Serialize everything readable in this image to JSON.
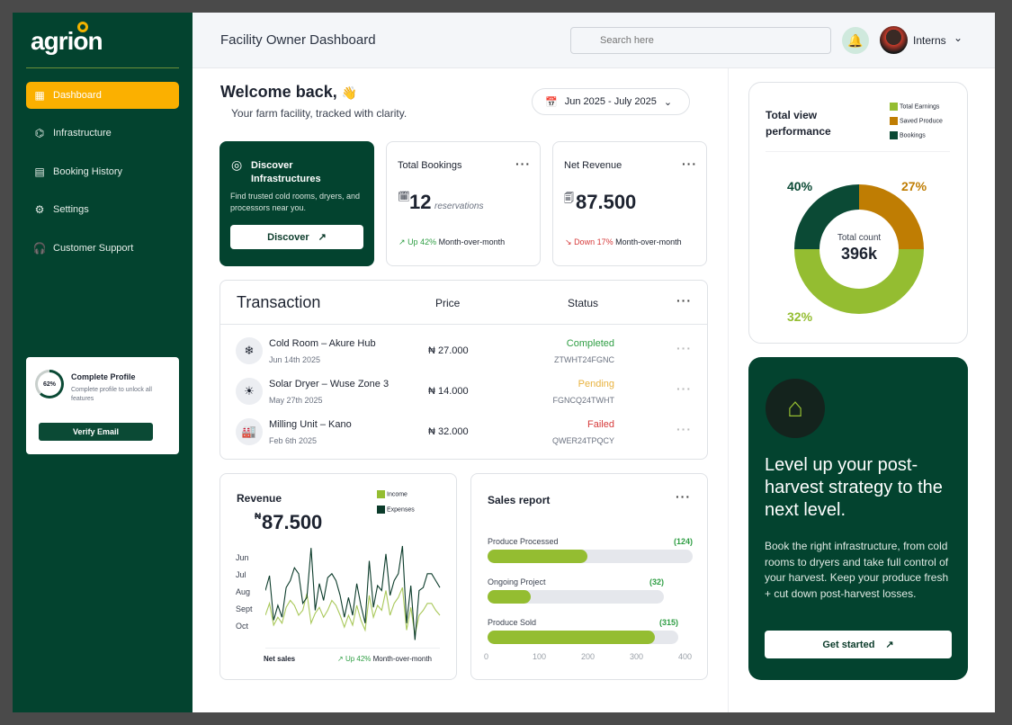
{
  "brand": {
    "name": "agrion"
  },
  "sidebar": {
    "items": [
      {
        "label": "Dashboard",
        "icon": "grid-icon"
      },
      {
        "label": "Infrastructure",
        "icon": "boxes-icon"
      },
      {
        "label": "Booking History",
        "icon": "receipt-search-icon"
      },
      {
        "label": "Settings",
        "icon": "gear-icon"
      },
      {
        "label": "Customer Support",
        "icon": "headset-icon"
      }
    ],
    "profile": {
      "percent": "62%",
      "title": "Complete Profile",
      "desc": "Complete profile to unlock all features",
      "button": "Verify Email"
    }
  },
  "header": {
    "title": "Facility Owner Dashboard",
    "search_placeholder": "Search here",
    "user": "Interns"
  },
  "welcome": {
    "title": "Welcome back,",
    "emoji": "👋",
    "subtitle": "Your farm facility, tracked with clarity.",
    "date_range": "Jun 2025 - July 2025"
  },
  "discover": {
    "title": "Discover Infrastructures",
    "desc": "Find trusted cold rooms, dryers, and processors near you.",
    "button": "Discover"
  },
  "bookings": {
    "title": "Total Bookings",
    "value": "12",
    "unit": "reservations",
    "trend": "Up 42%",
    "trend_suffix": "Month-over-month"
  },
  "net_revenue": {
    "title": "Net Revenue",
    "value": "87.500",
    "trend": "Down 17%",
    "trend_suffix": "Month-over-month"
  },
  "transactions": {
    "title": "Transaction",
    "col_price": "Price",
    "col_status": "Status",
    "rows": [
      {
        "name": "Cold Room – Akure Hub",
        "date": "Jun 14th 2025",
        "price": "₦ 27.000",
        "status": "Completed",
        "code": "ZTWHT24FGNC",
        "icon": "snowflake-icon"
      },
      {
        "name": "Solar Dryer – Wuse Zone 3",
        "date": "May 27th 2025",
        "price": "₦ 14.000",
        "status": "Pending",
        "code": "FGNCQ24TWHT",
        "icon": "solar-panel-icon"
      },
      {
        "name": "Milling Unit – Kano",
        "date": "Feb 6th 2025",
        "price": "₦ 32.000",
        "status": "Failed",
        "code": "QWER24TPQCY",
        "icon": "factory-icon"
      }
    ]
  },
  "revenue": {
    "title": "Revenue",
    "currency": "₦",
    "value": "87.500",
    "legend": [
      "Income",
      "Expenses"
    ],
    "footer_label": "Net sales",
    "trend": "Up 42%",
    "trend_suffix": "Month-over-month"
  },
  "chart_data": [
    {
      "type": "line",
      "title": "Revenue",
      "yticks": [
        "Jun",
        "Jul",
        "Aug",
        "Sept",
        "Oct"
      ],
      "series": [
        {
          "name": "Expenses",
          "color": "#0b3b2a",
          "values": [
            55,
            70,
            25,
            40,
            28,
            58,
            65,
            78,
            72,
            42,
            48,
            98,
            35,
            62,
            45,
            68,
            72,
            65,
            50,
            28,
            48,
            30,
            62,
            40,
            22,
            85,
            38,
            60,
            55,
            92,
            50,
            65,
            72,
            100,
            22,
            60,
            5,
            55,
            58,
            72,
            72,
            65,
            58
          ]
        },
        {
          "name": "Income",
          "color": "#a9c85a",
          "values": [
            30,
            42,
            20,
            28,
            22,
            38,
            45,
            40,
            30,
            35,
            52,
            22,
            32,
            38,
            28,
            35,
            45,
            40,
            30,
            18,
            30,
            20,
            40,
            25,
            15,
            50,
            28,
            40,
            35,
            55,
            30,
            42,
            48,
            58,
            15,
            38,
            10,
            30,
            35,
            42,
            42,
            35,
            30
          ]
        }
      ]
    },
    {
      "type": "bar",
      "title": "Sales report",
      "categories": [
        "Produce Processed",
        "Ongoing Project",
        "Produce Sold"
      ],
      "values": [
        124,
        32,
        315
      ],
      "xticks": [
        "0",
        "100",
        "200",
        "300",
        "400"
      ],
      "xlim": [
        0,
        400
      ]
    },
    {
      "type": "pie",
      "title": "Total view performance",
      "legend": [
        "Total Earnings",
        "Saved Produce",
        "Bookings"
      ],
      "colors": [
        "#94bd31",
        "#bf7d03",
        "#0b4a35"
      ],
      "labels": [
        "32%",
        "27%",
        "40%"
      ],
      "values": [
        32,
        27,
        40
      ],
      "center_label": "Total count",
      "center_value": "396k"
    }
  ],
  "promo": {
    "title": "Level up your post-harvest strategy to the next level.",
    "body": "Book the right infrastructure, from cold rooms to dryers and take full control of your harvest. Keep your produce fresh + cut down post-harvest losses.",
    "button": "Get started"
  }
}
